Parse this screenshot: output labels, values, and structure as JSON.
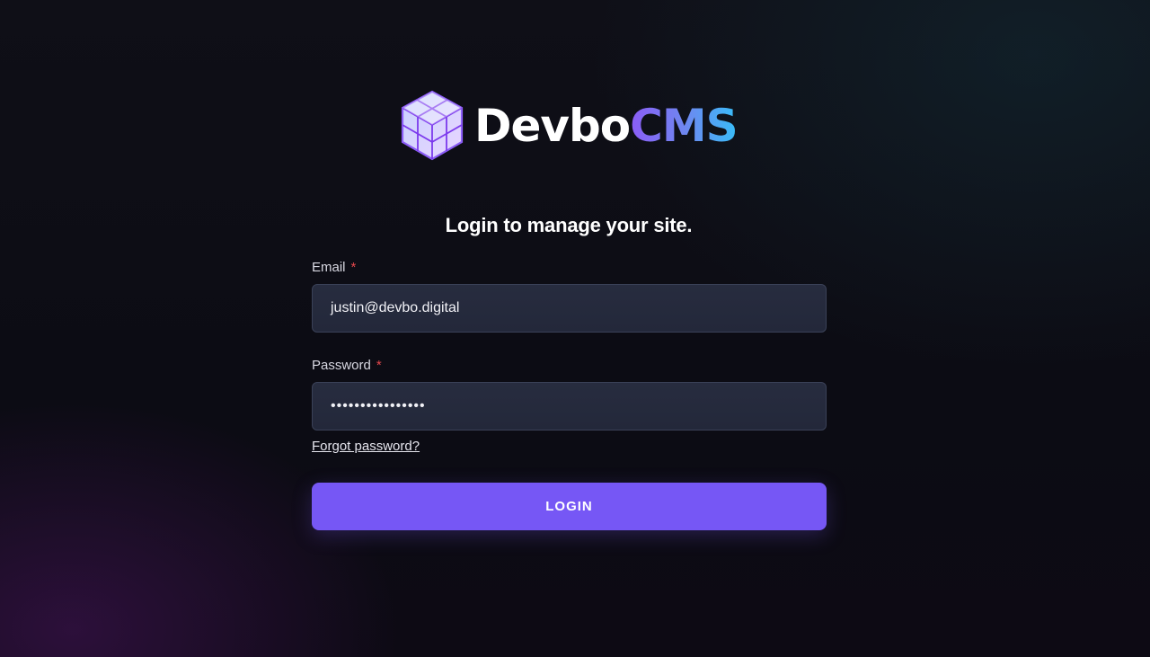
{
  "brand": {
    "name_primary": "Devbo",
    "name_accent": "CMS",
    "accent_gradient": [
      "#8b5cf6",
      "#38bdf8"
    ],
    "icon": "cube-logo-icon"
  },
  "heading": "Login to manage your site.",
  "form": {
    "email": {
      "label": "Email",
      "required_mark": "*",
      "value": "justin@devbo.digital"
    },
    "password": {
      "label": "Password",
      "required_mark": "*",
      "value": "••••••••••••••••"
    },
    "forgot_link": "Forgot password?",
    "submit_label": "LOGIN"
  },
  "colors": {
    "button": "#7657f5",
    "required": "#e5484d",
    "input_bg": "#272c3f"
  }
}
